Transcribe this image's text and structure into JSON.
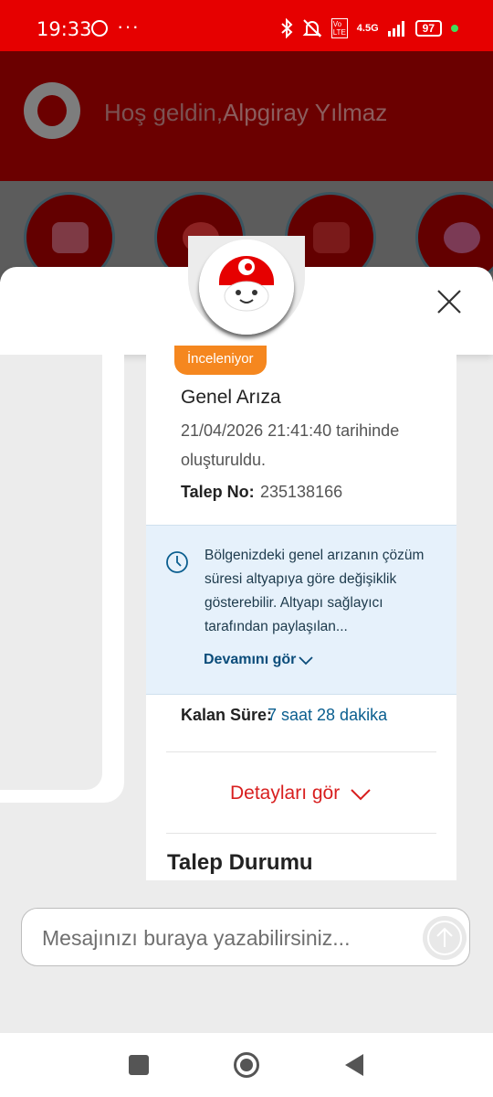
{
  "status_bar": {
    "time": "19:33",
    "more_dots": "···",
    "network": "4.5G",
    "battery": "97"
  },
  "header": {
    "greeting": "Hoş geldin,",
    "user_name": "Alpgiray Yılmaz"
  },
  "ticket": {
    "status_badge": "İnceleniyor",
    "title": "Genel Arıza",
    "created": "21/04/2026 21:41:40 tarihinde oluşturuldu.",
    "ticket_no_label": "Talep No:",
    "ticket_no_value": "235138166",
    "info_text": "Bölgenizdeki genel arızanın çözüm süresi altyapıya göre değişiklik gösterebilir. Altyapı sağlayıcı tarafından paylaşılan...",
    "read_more": "Devamını gör",
    "remaining_label": "Kalan Süre:",
    "remaining_value": "7 saat 28 dakika",
    "details_link": "Detayları gör",
    "status_heading": "Talep Durumu"
  },
  "composer": {
    "placeholder": "Mesajınızı buraya yazabilirsiniz..."
  },
  "colors": {
    "brand_red": "#e60000",
    "badge_orange": "#f5871f",
    "info_bg": "#e6f1fb",
    "link_blue": "#0a5e8f"
  },
  "icons": [
    "whatsapp-icon",
    "bluetooth-icon",
    "mute-bell-icon",
    "volte-icon",
    "signal-icon",
    "battery-icon",
    "vodafone-logo-icon",
    "card-icon",
    "pause-icon",
    "wifi-icon",
    "chart-icon",
    "bot-avatar-icon",
    "close-icon",
    "clock-icon",
    "chevron-down-icon",
    "send-arrow-icon",
    "nav-recents-icon",
    "nav-home-icon",
    "nav-back-icon"
  ]
}
